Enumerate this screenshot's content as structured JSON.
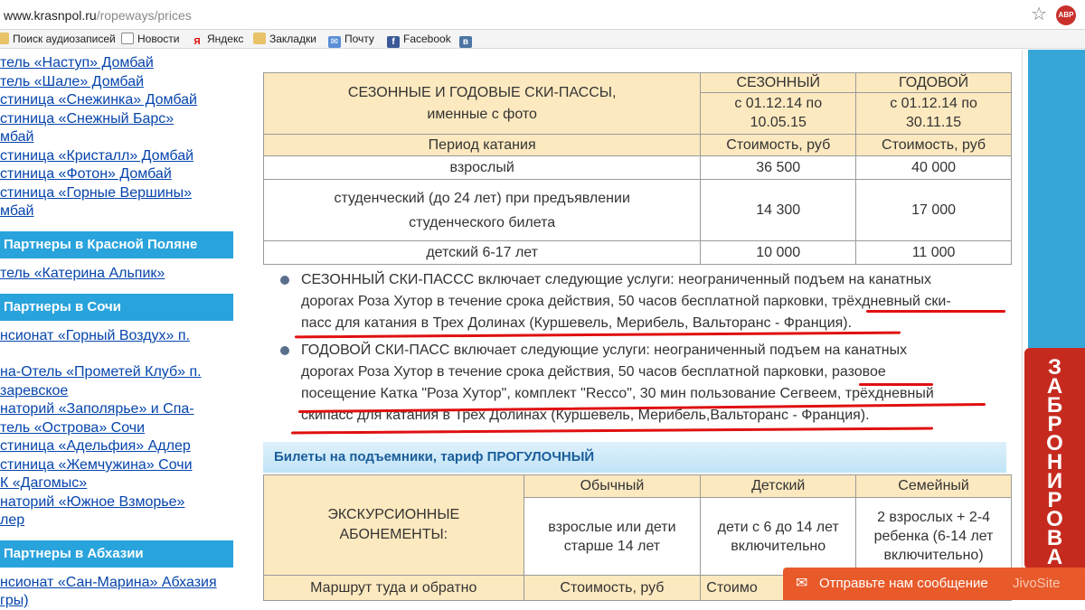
{
  "browser": {
    "url_host": "www.krasnpol.ru",
    "url_path": "/ropeways/prices",
    "abp": "ABP",
    "bookmarks": [
      {
        "label": "Поиск аудиозаписей",
        "icon": "folder-icon"
      },
      {
        "label": "Новости",
        "icon": "page-icon"
      },
      {
        "label": "Яндекс",
        "icon": "yandex-icon"
      },
      {
        "label": "Закладки",
        "icon": "folder-icon"
      },
      {
        "label": "Почту",
        "icon": "mail-icon"
      },
      {
        "label": "Facebook",
        "icon": "facebook-icon"
      },
      {
        "label": "",
        "icon": "vk-icon"
      }
    ]
  },
  "sidebar": {
    "links_top": [
      "тель «Наступ» Домбай",
      "тель «Шале» Домбай",
      "стиница «Снежинка» Домбай",
      "стиница «Снежный Барс»",
      "мбай",
      "стиница «Кристалл» Домбай",
      "стиница «Фотон» Домбай",
      "стиница «Горные Вершины»",
      "мбай"
    ],
    "head_krasnaya": "Партнеры в Красной Поляне",
    "links_krasnaya": [
      "тель «Катерина Альпик»"
    ],
    "head_sochi": "Партнеры в Сочи",
    "links_sochi": [
      "нсионат «Горный Воздух» п.",
      "на-Отель «Прометей Клуб» п.",
      "заревское",
      "наторий «Заполярье» и Спа-",
      "тель «Острова» Сочи",
      "стиница «Адельфия» Адлер",
      "стиница «Жемчужина» Сочи",
      "К «Дагомыс»",
      "наторий «Южное Взморье»",
      "лер"
    ],
    "head_abkhazia": "Партнеры в Абхазии",
    "links_abkhazia": [
      "нсионат «Сан-Марина» Абхазия",
      "гры)"
    ]
  },
  "table1": {
    "title_line1": "СЕЗОННЫЕ И ГОДОВЫЕ СКИ-ПАССЫ,",
    "title_line2": "именные с фото",
    "col_season": "СЕЗОННЫЙ",
    "col_year": "ГОДОВОЙ",
    "season_dates": "с 01.12.14 по 10.05.15",
    "year_dates": "с 01.12.14 по 30.11.15",
    "period_label": "Период катания",
    "cost_label": "Стоимость, руб",
    "rows": [
      {
        "label": "взрослый",
        "season": "36 500",
        "year": "40 000"
      },
      {
        "label": "студенческий (до 24 лет) при предъявлении студенческого билета",
        "season": "14 300",
        "year": "17 000"
      },
      {
        "label": "детский 6-17 лет",
        "season": "10 000",
        "year": "11 000"
      }
    ]
  },
  "bullets": {
    "b1": [
      "СЕЗОННЫЙ СКИ-ПАССС включает следующие услуги: неограниченный подъем на канатных",
      "дорогах Роза Хутор в течение срока действия, 50 часов бесплатной парковки, трёхдневный ски-",
      "пасс для катания в Трех Долинах (Куршевель, Мерибель, Вальторанс - Франция)."
    ],
    "b2": [
      "ГОДОВОЙ СКИ-ПАСС включает следующие услуги: неограниченный подъем на канатных",
      "дорогах Роза Хутор в течение срока действия, 50 часов бесплатной парковки, разовое",
      "посещение Катка \"Роза Хутор\", комплект \"Recco\", 30 мин пользование Сегвеем, трёхдневный",
      "скипасс для катания в Трех Долинах (Куршевель, Мерибель,Вальторанс - Франция)."
    ]
  },
  "section2": {
    "title_prefix": "Билеты на подъемники, тариф ",
    "title_emph": "ПРОГУЛОЧНЫЙ"
  },
  "table2": {
    "title_line1": "ЭКСКУРСИОННЫЕ",
    "title_line2": "АБОНЕМЕНТЫ:",
    "col_regular": "Обычный",
    "col_child": "Детский",
    "col_family": "Семейный",
    "regular_desc": "взрослые или дети старше 14 лет",
    "child_desc": "дети с 6 до 14 лет включительно",
    "family_desc": "2 взрослых + 2-4 ребенка (6-14 лет включительно)",
    "route_label": "Маршрут туда и обратно",
    "cost_regular": "Стоимость, руб",
    "cost_child": "Стоимо"
  },
  "booking_tab": {
    "letters": [
      "З",
      "А",
      "Б",
      "Р",
      "О",
      "Н",
      "И",
      "Р",
      "О",
      "В",
      "А"
    ]
  },
  "jivo": {
    "text": "Отправьте нам сообщение",
    "brand": "JivoSite"
  },
  "colors": {
    "sidebar_head": "#29a3dc",
    "table_bg": "#fde9bf",
    "booking": "#c62a1f",
    "jivo": "#e85a2a",
    "underline": "#e01010"
  }
}
